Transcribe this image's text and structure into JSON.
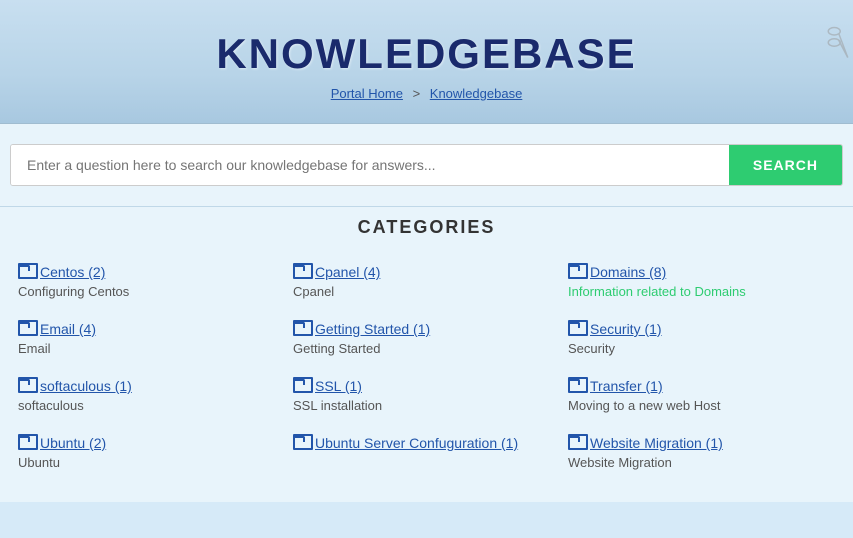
{
  "header": {
    "title": "KNOWLEDGEBASE",
    "breadcrumb": {
      "home_label": "Portal Home",
      "separator": ">",
      "current_label": "Knowledgebase"
    }
  },
  "search": {
    "placeholder": "Enter a question here to search our knowledgebase for answers...",
    "button_label": "SEARCH"
  },
  "categories_title": "CATEGORIES",
  "categories": [
    {
      "name": "Centos (2)",
      "desc": "Configuring Centos",
      "desc_class": "normal"
    },
    {
      "name": "Cpanel (4)",
      "desc": "Cpanel",
      "desc_class": "normal"
    },
    {
      "name": "Domains (8)",
      "desc": "Information related to Domains",
      "desc_class": "green"
    },
    {
      "name": "Email (4)",
      "desc": "Email",
      "desc_class": "normal"
    },
    {
      "name": "Getting Started (1)",
      "desc": "Getting Started",
      "desc_class": "normal"
    },
    {
      "name": "Security (1)",
      "desc": "Security",
      "desc_class": "normal"
    },
    {
      "name": "softaculous (1)",
      "desc": "softaculous",
      "desc_class": "normal"
    },
    {
      "name": "SSL (1)",
      "desc": "SSL installation",
      "desc_class": "normal"
    },
    {
      "name": "Transfer (1)",
      "desc": "Moving to a new web Host",
      "desc_class": "normal"
    },
    {
      "name": "Ubuntu (2)",
      "desc": "Ubuntu",
      "desc_class": "normal"
    },
    {
      "name": "Ubuntu Server Confuguration (1)",
      "desc": "",
      "desc_class": "normal"
    },
    {
      "name": "Website Migration (1)",
      "desc": "Website Migration",
      "desc_class": "normal"
    }
  ]
}
